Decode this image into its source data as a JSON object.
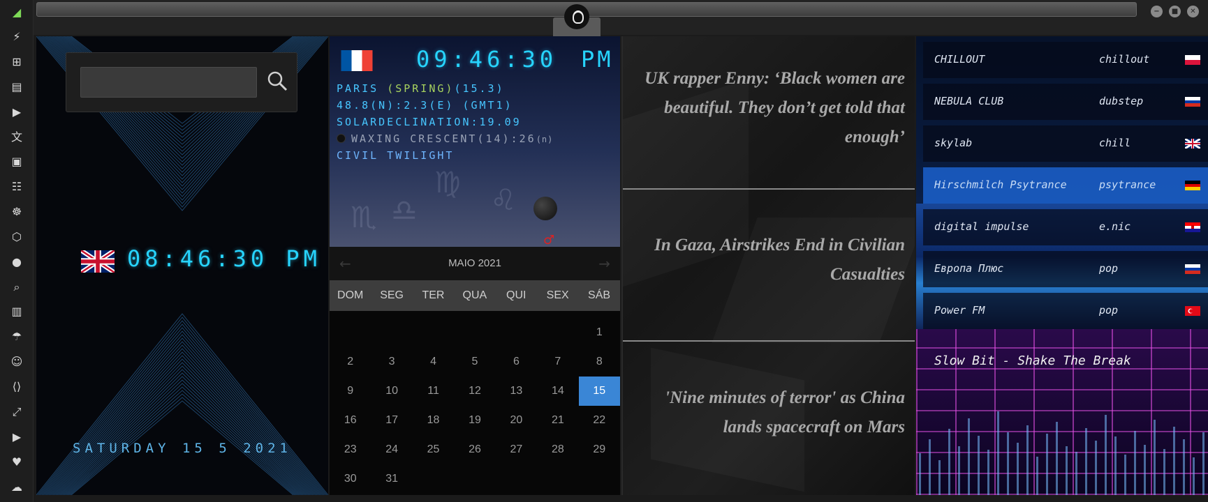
{
  "rail": {
    "icons": [
      "wifi-icon",
      "lightning-icon",
      "windows-icon",
      "archive-icon",
      "play-icon",
      "translate-icon",
      "image-icon",
      "newspaper-icon",
      "helm-icon",
      "hexagon-icon",
      "globe-icon",
      "search-icon",
      "map-icon",
      "umbrella-icon",
      "contacts-icon",
      "code-icon",
      "expand-icon",
      "youtube-icon",
      "heart-icon",
      "cloud-icon"
    ],
    "glyphs": [
      "◢",
      "⚡",
      "⊞",
      "▤",
      "▶",
      "文",
      "▣",
      "☷",
      "☸",
      "⬡",
      "●",
      "⌕",
      "▥",
      "☂",
      "☺",
      "⟨⟩",
      "⤢",
      "▶",
      "♥",
      "☁"
    ]
  },
  "window": {
    "minimize_glyph": "−",
    "maximize_glyph": "■",
    "close_glyph": "✕"
  },
  "clock": {
    "search_value": "",
    "time": "08:46:30 PM",
    "date": "SATURDAY 15 5 2021",
    "flag": "uk"
  },
  "astro": {
    "time": "09:46:30",
    "ampm": "PM",
    "city": "PARIS ",
    "season": "(SPRING)",
    "season_value": "(15.3)",
    "coords": "48.8(N):2.3(E) (GMT1)",
    "declination": "SOLARDECLINATION:19.09",
    "moon": "WAXING CRESCENT(14):26",
    "moon_sup": "(n)",
    "twilight": "CIVIL TWILIGHT",
    "flag": "fr"
  },
  "calendar": {
    "prev": "←",
    "next": "→",
    "title": "MAIO 2021",
    "weekdays": [
      "DOM",
      "SEG",
      "TER",
      "QUA",
      "QUI",
      "SEX",
      "SÁB"
    ],
    "leading_blanks": 6,
    "days": 31,
    "today": 15
  },
  "news": [
    "UK rapper Enny: ‘Black women are beautiful. They don’t get told that enough’",
    "In Gaza, Airstrikes End in Civilian Casualties",
    "'Nine minutes of terror' as China lands spacecraft on Mars"
  ],
  "radio": {
    "stations": [
      {
        "name": "CHILLOUT",
        "genre": "chillout",
        "flag": "pl",
        "active": false
      },
      {
        "name": "NEBULA CLUB",
        "genre": "dubstep",
        "flag": "ru",
        "active": false
      },
      {
        "name": "skylab",
        "genre": "chill",
        "flag": "uk",
        "active": false
      },
      {
        "name": "Hirschmilch Psytrance",
        "genre": "psytrance",
        "flag": "de",
        "active": true
      },
      {
        "name": "digital impulse",
        "genre": "e.nic",
        "flag": "hr",
        "active": false
      },
      {
        "name": "Европа Плюс",
        "genre": "pop",
        "flag": "ru",
        "active": false
      },
      {
        "name": "Power FM",
        "genre": "pop",
        "flag": "tr",
        "active": false
      }
    ],
    "now_playing": "Slow Bit - Shake The Break"
  },
  "colors": {
    "accent_cyan": "#27d4ff",
    "calendar_today": "#3a86d6",
    "season_green": "#a7d25e"
  }
}
